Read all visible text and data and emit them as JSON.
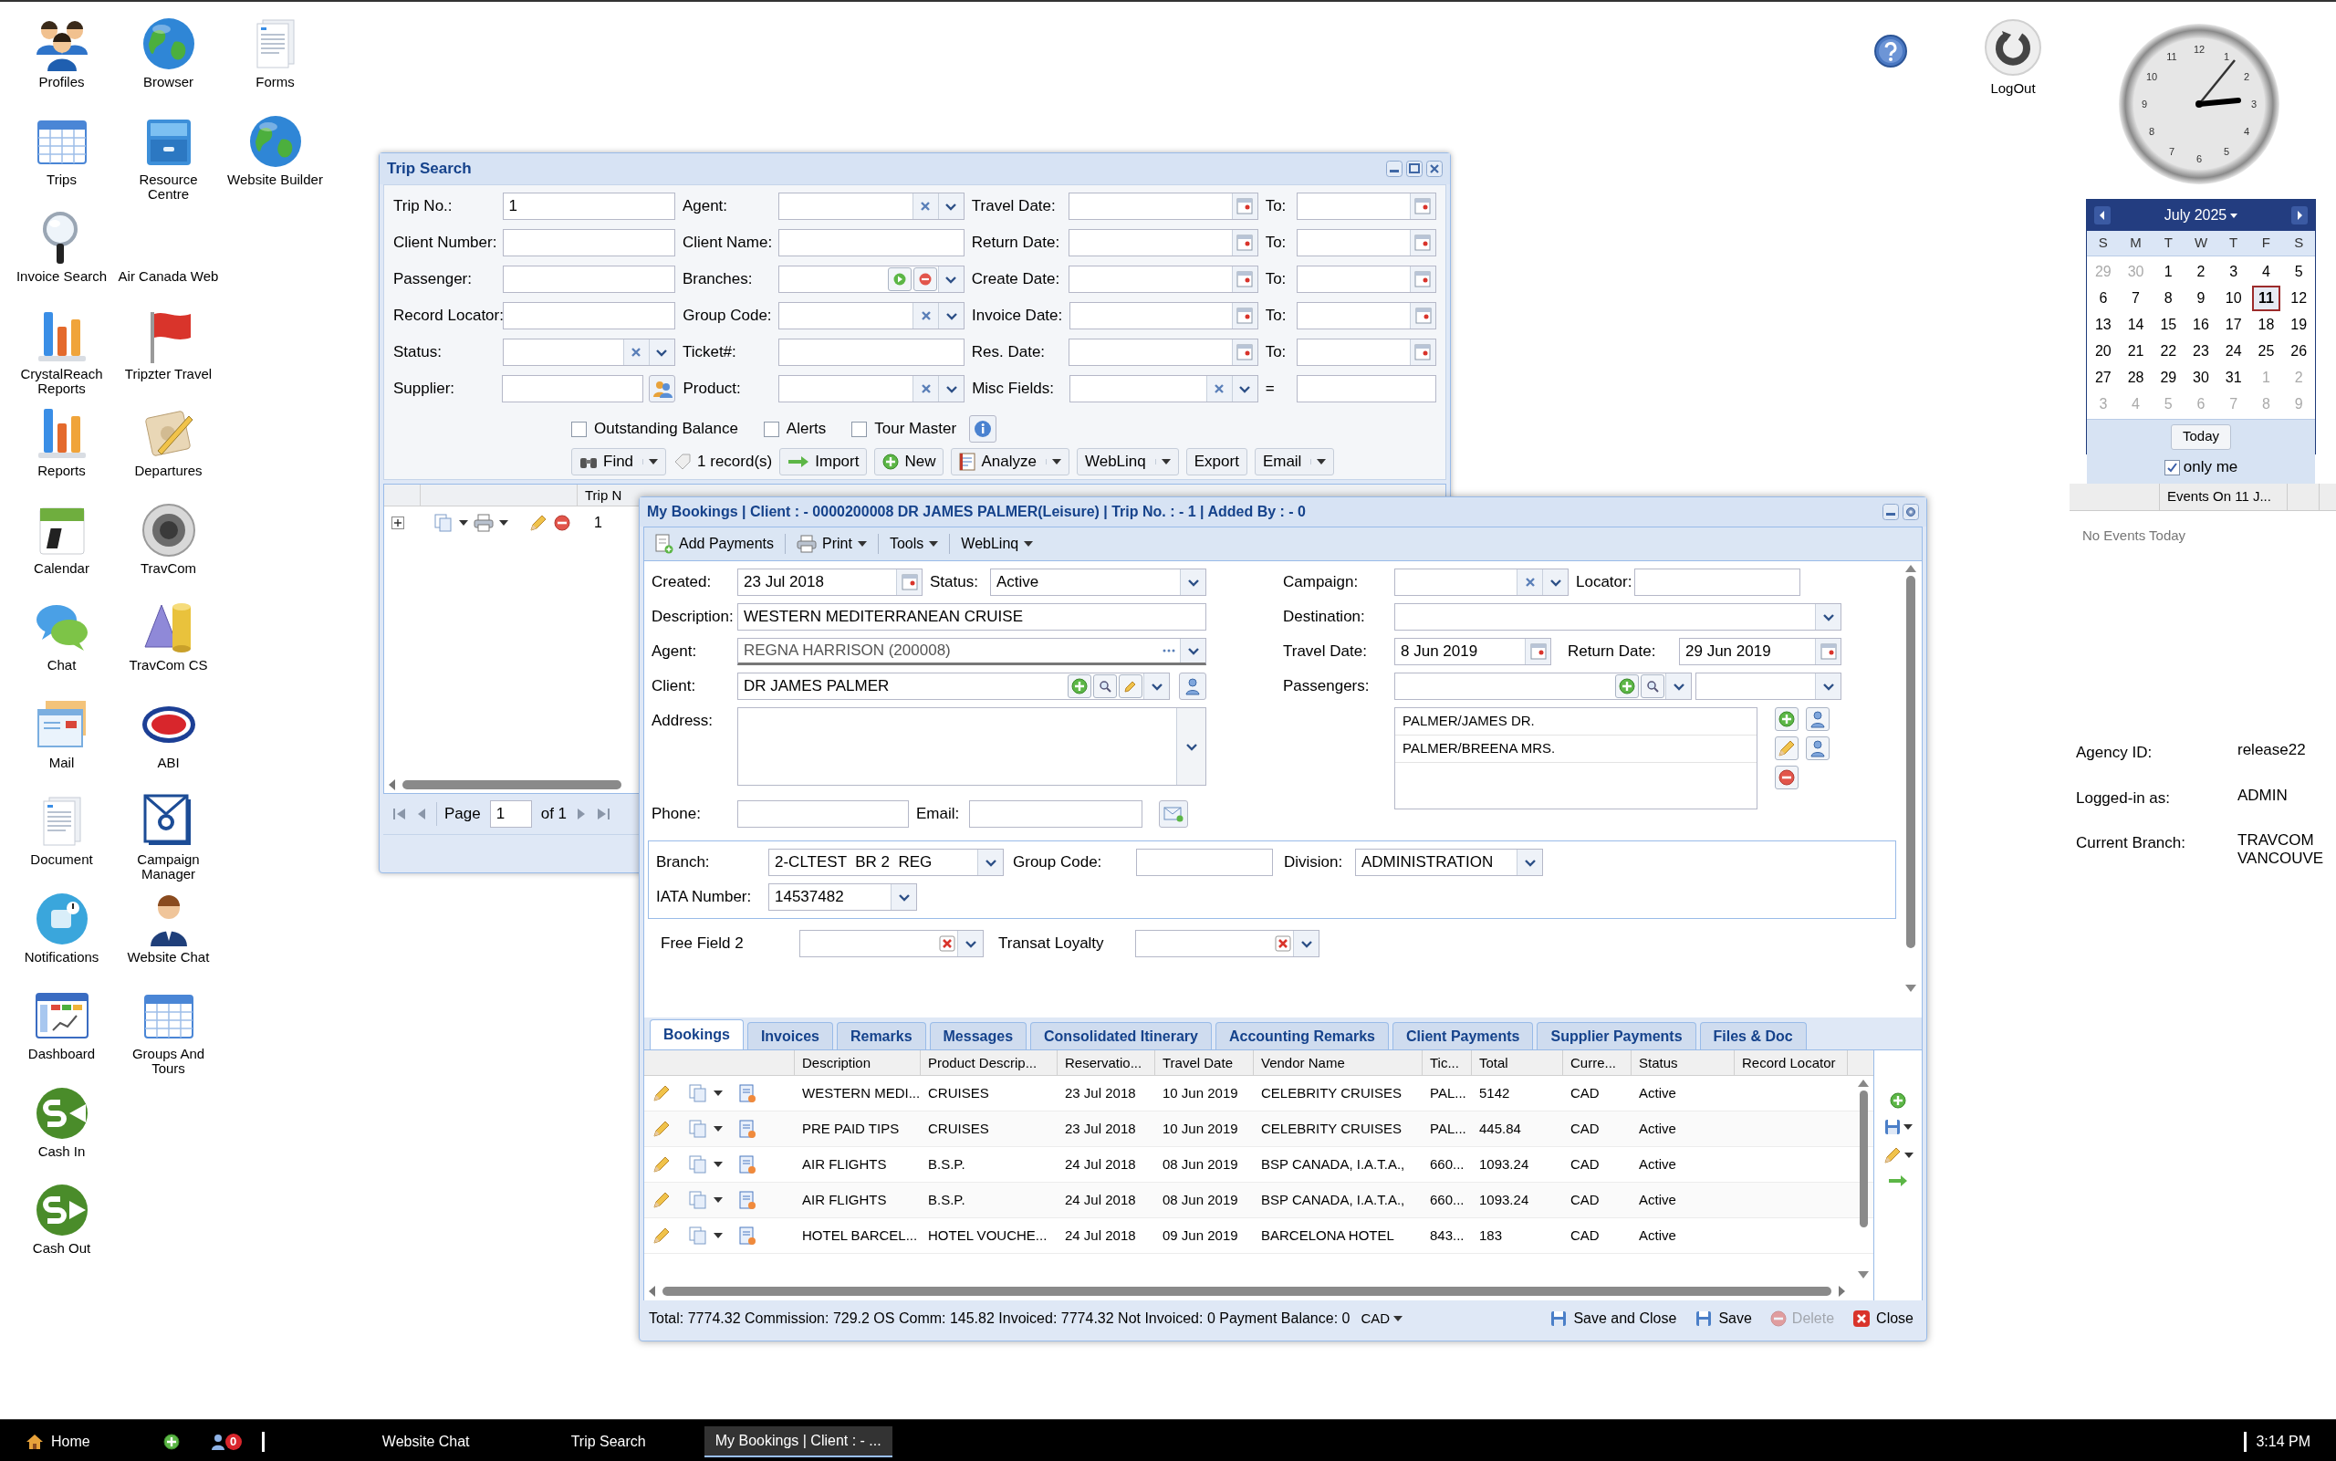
{
  "desktop_icons": [
    [
      {
        "label": "Profiles",
        "kind": "people"
      },
      {
        "label": "Trips",
        "kind": "grid"
      },
      {
        "label": "Invoice Search",
        "kind": "magnifier"
      },
      {
        "label": "CrystalReach Reports",
        "kind": "bars"
      },
      {
        "label": "Reports",
        "kind": "bars"
      },
      {
        "label": "Calendar",
        "kind": "calendar"
      },
      {
        "label": "Chat",
        "kind": "chat"
      },
      {
        "label": "Mail",
        "kind": "mail"
      },
      {
        "label": "Document",
        "kind": "doc"
      },
      {
        "label": "Notifications",
        "kind": "notification"
      },
      {
        "label": "Dashboard",
        "kind": "dashboard"
      },
      {
        "label": "Cash In",
        "kind": "cashin"
      },
      {
        "label": "Cash Out",
        "kind": "cashout"
      }
    ],
    [
      {
        "label": "Browser",
        "kind": "globe"
      },
      {
        "label": "Resource Centre",
        "kind": "cabinet"
      },
      {
        "label": "Air Canada Web",
        "kind": "none"
      },
      {
        "label": "Tripzter Travel",
        "kind": "flag"
      },
      {
        "label": "Departures",
        "kind": "notepad"
      },
      {
        "label": "TravCom",
        "kind": "speaker"
      },
      {
        "label": "TravCom CS",
        "kind": "shapes"
      },
      {
        "label": "ABI",
        "kind": "oval"
      },
      {
        "label": "Campaign Manager",
        "kind": "envelope"
      },
      {
        "label": "Website Chat",
        "kind": "agent"
      },
      {
        "label": "Groups And Tours",
        "kind": "grid"
      }
    ],
    [
      {
        "label": "Forms",
        "kind": "doc"
      },
      {
        "label": "Website Builder",
        "kind": "globe"
      }
    ]
  ],
  "logout": {
    "label": "LogOut"
  },
  "clock": {
    "numerals": [
      "12",
      "1",
      "2",
      "3",
      "4",
      "5",
      "6",
      "7",
      "8",
      "9",
      "10",
      "11"
    ]
  },
  "calendar": {
    "month": "July 2025",
    "weekdays": [
      "S",
      "M",
      "T",
      "W",
      "T",
      "F",
      "S"
    ],
    "days": [
      {
        "label": "29",
        "other_month": true,
        "selected": false
      },
      {
        "label": "30",
        "other_month": true,
        "selected": false
      },
      {
        "label": "1",
        "other_month": false,
        "selected": false
      },
      {
        "label": "2",
        "other_month": false,
        "selected": false
      },
      {
        "label": "3",
        "other_month": false,
        "selected": false
      },
      {
        "label": "4",
        "other_month": false,
        "selected": false
      },
      {
        "label": "5",
        "other_month": false,
        "selected": false
      },
      {
        "label": "6",
        "other_month": false,
        "selected": false
      },
      {
        "label": "7",
        "other_month": false,
        "selected": false
      },
      {
        "label": "8",
        "other_month": false,
        "selected": false
      },
      {
        "label": "9",
        "other_month": false,
        "selected": false
      },
      {
        "label": "10",
        "other_month": false,
        "selected": false
      },
      {
        "label": "11",
        "other_month": false,
        "selected": true
      },
      {
        "label": "12",
        "other_month": false,
        "selected": false
      },
      {
        "label": "13",
        "other_month": false,
        "selected": false
      },
      {
        "label": "14",
        "other_month": false,
        "selected": false
      },
      {
        "label": "15",
        "other_month": false,
        "selected": false
      },
      {
        "label": "16",
        "other_month": false,
        "selected": false
      },
      {
        "label": "17",
        "other_month": false,
        "selected": false
      },
      {
        "label": "18",
        "other_month": false,
        "selected": false
      },
      {
        "label": "19",
        "other_month": false,
        "selected": false
      },
      {
        "label": "20",
        "other_month": false,
        "selected": false
      },
      {
        "label": "21",
        "other_month": false,
        "selected": false
      },
      {
        "label": "22",
        "other_month": false,
        "selected": false
      },
      {
        "label": "23",
        "other_month": false,
        "selected": false
      },
      {
        "label": "24",
        "other_month": false,
        "selected": false
      },
      {
        "label": "25",
        "other_month": false,
        "selected": false
      },
      {
        "label": "26",
        "other_month": false,
        "selected": false
      },
      {
        "label": "27",
        "other_month": false,
        "selected": false
      },
      {
        "label": "28",
        "other_month": false,
        "selected": false
      },
      {
        "label": "29",
        "other_month": false,
        "selected": false
      },
      {
        "label": "30",
        "other_month": false,
        "selected": false
      },
      {
        "label": "31",
        "other_month": false,
        "selected": false
      },
      {
        "label": "1",
        "other_month": true,
        "selected": false
      },
      {
        "label": "2",
        "other_month": true,
        "selected": false
      },
      {
        "label": "3",
        "other_month": true,
        "selected": false
      },
      {
        "label": "4",
        "other_month": true,
        "selected": false
      },
      {
        "label": "5",
        "other_month": true,
        "selected": false
      },
      {
        "label": "6",
        "other_month": true,
        "selected": false
      },
      {
        "label": "7",
        "other_month": true,
        "selected": false
      },
      {
        "label": "8",
        "other_month": true,
        "selected": false
      },
      {
        "label": "9",
        "other_month": true,
        "selected": false
      }
    ],
    "today_button": "Today",
    "only_me": {
      "label": "only me",
      "checked": true
    },
    "events_header": "Events On 11 J...",
    "events_empty": "No Events Today"
  },
  "agency_info": [
    {
      "label": "Agency ID:",
      "value": "release22"
    },
    {
      "label": "Logged-in as:",
      "value": "ADMIN"
    },
    {
      "label": "Current Branch:",
      "value": "TRAVCOM VANCOUVE"
    }
  ],
  "trip_search": {
    "title": "Trip Search",
    "rows": [
      {
        "cells": [
          {
            "label": "Trip No.:",
            "kind": "text",
            "value": "1"
          },
          {
            "label": "Agent:",
            "kind": "combo"
          },
          {
            "label": "Travel Date:",
            "kind": "date"
          },
          {
            "label": "To:",
            "kind": "date"
          }
        ]
      },
      {
        "cells": [
          {
            "label": "Client Number:",
            "kind": "text"
          },
          {
            "label": "Client Name:",
            "kind": "text"
          },
          {
            "label": "Return Date:",
            "kind": "date"
          },
          {
            "label": "To:",
            "kind": "date"
          }
        ]
      },
      {
        "cells": [
          {
            "label": "Passenger:",
            "kind": "text"
          },
          {
            "label": "Branches:",
            "kind": "branches"
          },
          {
            "label": "Create Date:",
            "kind": "date"
          },
          {
            "label": "To:",
            "kind": "date"
          }
        ]
      },
      {
        "cells": [
          {
            "label": "Record Locator:",
            "kind": "text"
          },
          {
            "label": "Group Code:",
            "kind": "combo"
          },
          {
            "label": "Invoice Date:",
            "kind": "date"
          },
          {
            "label": "To:",
            "kind": "date"
          }
        ]
      },
      {
        "cells": [
          {
            "label": "Status:",
            "kind": "combo"
          },
          {
            "label": "Ticket#:",
            "kind": "text"
          },
          {
            "label": "Res. Date:",
            "kind": "date"
          },
          {
            "label": "To:",
            "kind": "date"
          }
        ]
      },
      {
        "cells": [
          {
            "label": "Supplier:",
            "kind": "lookup"
          },
          {
            "label": "Product:",
            "kind": "combo"
          },
          {
            "label": "Misc Fields:",
            "kind": "combo"
          },
          {
            "label": "=",
            "kind": "text"
          }
        ]
      }
    ],
    "checkboxes": [
      {
        "label": "Outstanding Balance",
        "checked": false
      },
      {
        "label": "Alerts",
        "checked": false
      },
      {
        "label": "Tour Master",
        "checked": false
      }
    ],
    "toolbar": [
      {
        "label": "Find",
        "kind": "find",
        "menu": true
      },
      {
        "label": "1 record(s)",
        "kind": "count"
      },
      {
        "label": "Import",
        "kind": "import",
        "menu": false
      },
      {
        "label": "New",
        "kind": "new",
        "menu": false
      },
      {
        "label": "Analyze",
        "kind": "analyze",
        "menu": true
      },
      {
        "label": "WebLinq",
        "kind": "plain",
        "menu": true
      },
      {
        "label": "Export",
        "kind": "plain",
        "menu": false
      },
      {
        "label": "Email",
        "kind": "plain",
        "menu": true
      }
    ],
    "grid_header": "Trip N",
    "grid_row": "1",
    "pager": {
      "page_label": "Page",
      "page": "1",
      "of": "of 1"
    }
  },
  "my_bookings": {
    "title": "My Bookings | Client : - 0000200008 DR JAMES PALMER(Leisure) | Trip No. : - 1 | Added By : - 0",
    "toolbar": [
      {
        "label": "Add Payments",
        "kind": "payments",
        "menu": false
      },
      {
        "label": "Print",
        "kind": "print",
        "menu": true
      },
      {
        "label": "Tools",
        "kind": "plain",
        "menu": true
      },
      {
        "label": "WebLinq",
        "kind": "plain",
        "menu": true
      }
    ],
    "created": {
      "label": "Created:",
      "value": "23 Jul 2018"
    },
    "status": {
      "label": "Status:",
      "value": "Active"
    },
    "description": {
      "label": "Description:",
      "value": "WESTERN MEDITERRANEAN CRUISE"
    },
    "agent": {
      "label": "Agent:",
      "value": "REGNA HARRISON (200008)"
    },
    "client": {
      "label": "Client:",
      "value": "DR JAMES PALMER"
    },
    "address": {
      "label": "Address:"
    },
    "phone": {
      "label": "Phone:"
    },
    "email": {
      "label": "Email:"
    },
    "campaign": {
      "label": "Campaign:"
    },
    "locator": {
      "label": "Locator:"
    },
    "destination": {
      "label": "Destination:"
    },
    "travel_date": {
      "label": "Travel Date:",
      "value": "8 Jun 2019"
    },
    "return_date": {
      "label": "Return Date:",
      "value": "29 Jun 2019"
    },
    "passengers": {
      "label": "Passengers:",
      "list": [
        "PALMER/JAMES DR.",
        "PALMER/BREENA MRS."
      ]
    },
    "branch": {
      "label": "Branch:",
      "value": "2-CLTEST  BR 2  REG"
    },
    "group_code": {
      "label": "Group Code:"
    },
    "division": {
      "label": "Division:",
      "value": "ADMINISTRATION"
    },
    "iata": {
      "label": "IATA Number:",
      "value": "14537482"
    },
    "free_fields": [
      {
        "label": "Free Field 2"
      },
      {
        "label": "Transat Loyalty"
      }
    ],
    "tabs": [
      {
        "label": "Bookings",
        "selected": true
      },
      {
        "label": "Invoices",
        "selected": false
      },
      {
        "label": "Remarks",
        "selected": false
      },
      {
        "label": "Messages",
        "selected": false
      },
      {
        "label": "Consolidated Itinerary",
        "selected": false
      },
      {
        "label": "Accounting Remarks",
        "selected": false
      },
      {
        "label": "Client Payments",
        "selected": false
      },
      {
        "label": "Supplier Payments",
        "selected": false
      },
      {
        "label": "Files & Doc",
        "selected": false
      }
    ],
    "columns": [
      "Description",
      "Product Descrip...",
      "Reservatio...",
      "Travel Date",
      "Vendor Name",
      "Tic...",
      "Total",
      "Curre...",
      "Status",
      "Record Locator"
    ],
    "rows": [
      [
        "WESTERN MEDI...",
        "CRUISES",
        "23 Jul 2018",
        "10 Jun 2019",
        "CELEBRITY CRUISES",
        "PAL...",
        "5142",
        "CAD",
        "Active"
      ],
      [
        "PRE PAID TIPS",
        "CRUISES",
        "23 Jul 2018",
        "10 Jun 2019",
        "CELEBRITY CRUISES",
        "PAL...",
        "445.84",
        "CAD",
        "Active"
      ],
      [
        "AIR FLIGHTS",
        "B.S.P.",
        "24 Jul 2018",
        "08 Jun 2019",
        "BSP CANADA, I.A.T.A.,",
        "660...",
        "1093.24",
        "CAD",
        "Active"
      ],
      [
        "AIR FLIGHTS",
        "B.S.P.",
        "24 Jul 2018",
        "08 Jun 2019",
        "BSP CANADA, I.A.T.A.,",
        "660...",
        "1093.24",
        "CAD",
        "Active"
      ],
      [
        "HOTEL BARCEL...",
        "HOTEL VOUCHE...",
        "24 Jul 2018",
        "09 Jun 2019",
        "BARCELONA HOTEL",
        "843...",
        "183",
        "CAD",
        "Active"
      ]
    ],
    "totals": "Total: 7774.32 Commission: 729.2 OS Comm: 145.82 Invoiced: 7774.32 Not Invoiced: 0 Payment Balance: 0",
    "currency": "CAD",
    "buttons": [
      {
        "label": "Save and Close",
        "kind": "save",
        "disabled": false
      },
      {
        "label": "Save",
        "kind": "save",
        "disabled": false
      },
      {
        "label": "Delete",
        "kind": "delete",
        "disabled": true
      },
      {
        "label": "Close",
        "kind": "close",
        "disabled": false
      }
    ]
  },
  "taskbar": {
    "home": "Home",
    "alerts_badge": "0",
    "windows": [
      {
        "label": "Website Chat",
        "selected": false
      },
      {
        "label": "Trip Search",
        "selected": false
      },
      {
        "label": "My Bookings | Client : - ...",
        "selected": true
      }
    ],
    "time": "3:14 PM"
  }
}
